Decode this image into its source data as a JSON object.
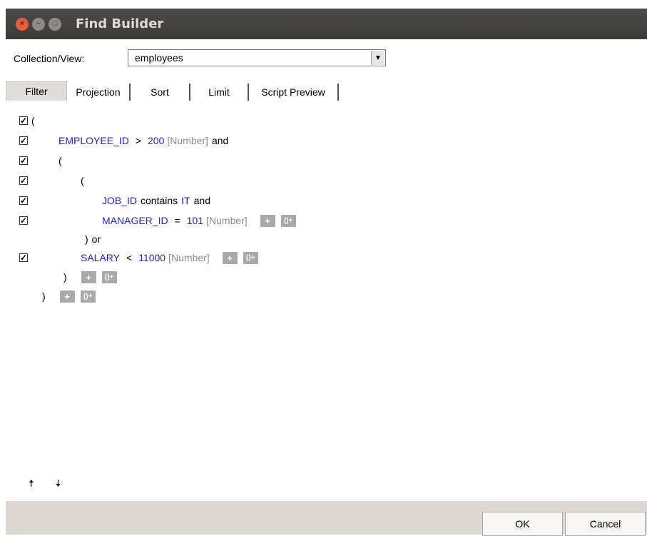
{
  "window": {
    "title": "Find Builder"
  },
  "collection": {
    "label": "Collection/View:",
    "value": "employees"
  },
  "tabs": [
    "Filter",
    "Projection",
    "Sort",
    "Limit",
    "Script Preview"
  ],
  "filter": {
    "r1": {
      "paren": "("
    },
    "r2": {
      "field": "EMPLOYEE_ID",
      "op": ">",
      "value": "200",
      "type": "[Number]",
      "conj": "and"
    },
    "r3": {
      "paren": "("
    },
    "r4": {
      "paren": "("
    },
    "r5": {
      "field": "JOB_ID",
      "op": "contains",
      "value": "IT",
      "conj": "and"
    },
    "r6": {
      "field": "MANAGER_ID",
      "op": "=",
      "value": "101",
      "type": "[Number]"
    },
    "r7": {
      "paren": ")",
      "conj": "or"
    },
    "r8": {
      "field": "SALARY",
      "op": "<",
      "value": "11000",
      "type": "[Number]"
    },
    "r9": {
      "paren": ")"
    },
    "r10": {
      "paren": ")"
    },
    "add_label": "+",
    "group_label": "()+"
  },
  "move": {
    "up": "🠅",
    "down": "🠇"
  },
  "buttons": {
    "ok": "OK",
    "cancel": "Cancel"
  }
}
